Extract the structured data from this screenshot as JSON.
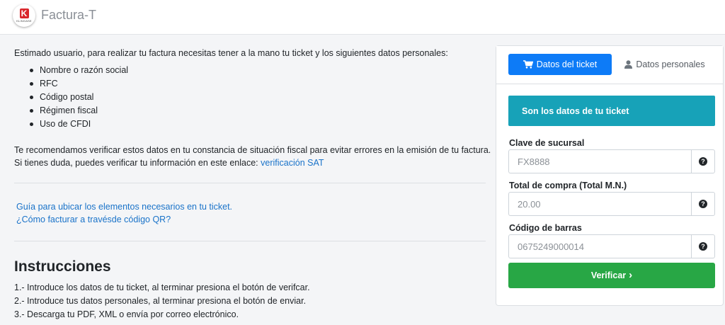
{
  "header": {
    "logo_text": "K",
    "logo_subtext": "KLINGASE",
    "title": "Factura-T"
  },
  "intro": {
    "text": "Estimado usuario, para realizar tu factura necesitas tener a la mano tu ticket y los siguientes datos personales:",
    "requirements": [
      "Nombre o razón social",
      "RFC",
      "Código postal",
      "Régimen fiscal",
      "Uso de CFDI"
    ]
  },
  "recommendation": {
    "line1": "Te recomendamos verificar estos datos en tu constancia de situación fiscal para evitar errores en la emisión de tu factura.",
    "line2_prefix": "Si tienes duda, puedes verificar tu información en este enlace: ",
    "link_label": "verificación SAT"
  },
  "guides": {
    "link1": "Guía para ubicar los elementos necesarios en tu ticket.",
    "link2": "¿Cómo facturar a travésde código QR?"
  },
  "instructions": {
    "title": "Instrucciones",
    "steps": [
      "1.- Introduce los datos de tu ticket, al terminar presiona el botón de verifcar.",
      "2.- Introduce tus datos personales, al terminar presiona el botón de enviar.",
      "3.- Descarga tu PDF, XML o envía por correo electrónico."
    ]
  },
  "card": {
    "tab_ticket": "Datos del ticket",
    "tab_personal": "Datos personales",
    "alert": "Son los datos de tu ticket",
    "fields": [
      {
        "label": "Clave de sucursal",
        "placeholder": "FX8888"
      },
      {
        "label": "Total de compra (Total M.N.)",
        "placeholder": "20.00"
      },
      {
        "label": "Código de barras",
        "placeholder": "0675249000014"
      }
    ],
    "help_glyph": "?",
    "verify_label": "Verificar",
    "verify_glyph": "›"
  },
  "colors": {
    "primary": "#0d7bf7",
    "info": "#17a2b8",
    "success": "#28a745",
    "link": "#1a73c9"
  }
}
